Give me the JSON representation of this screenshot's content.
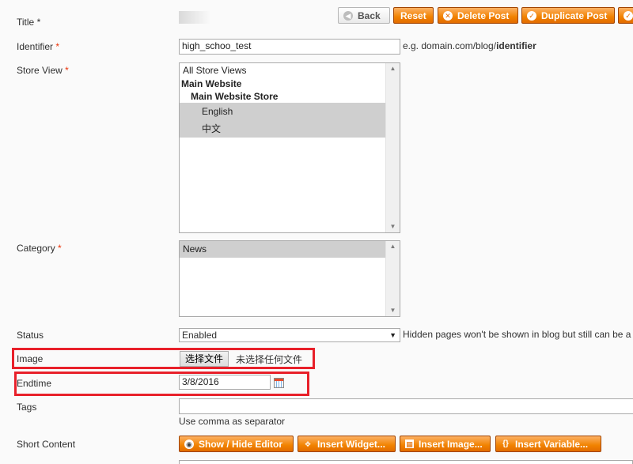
{
  "header": {
    "back_label": "Back",
    "reset_label": "Reset",
    "delete_label": "Delete Post",
    "duplicate_label": "Duplicate Post"
  },
  "form": {
    "title": {
      "label": "Title",
      "required": "*"
    },
    "identifier": {
      "label": "Identifier",
      "required": "*",
      "value": "high_schoo_test",
      "note_prefix": "e.g. domain.com/blog/",
      "note_bold": "identifier"
    },
    "store_view": {
      "label": "Store View",
      "required": "*",
      "options": [
        {
          "text": "All Store Views",
          "style": "normal",
          "selected": false
        },
        {
          "text": "Main Website",
          "style": "bold",
          "selected": false
        },
        {
          "text": "Main Website Store",
          "style": "bold",
          "selected": false
        },
        {
          "text": "English",
          "style": "normal",
          "selected": true
        },
        {
          "text": "中文",
          "style": "normal",
          "selected": true
        }
      ]
    },
    "category": {
      "label": "Category",
      "required": "*",
      "options": [
        {
          "text": "News",
          "selected": true
        }
      ]
    },
    "status": {
      "label": "Status",
      "value": "Enabled",
      "note": "Hidden pages won't be shown in blog but still can be a"
    },
    "image": {
      "label": "Image",
      "button_label": "选择文件",
      "file_text": "未选择任何文件"
    },
    "endtime": {
      "label": "Endtime",
      "value": "3/8/2016"
    },
    "tags": {
      "label": "Tags",
      "value": "",
      "hint": "Use comma as separator"
    },
    "short_content": {
      "label": "Short Content",
      "buttons": [
        "Show / Hide Editor",
        "Insert Widget...",
        "Insert Image...",
        "Insert Variable..."
      ]
    }
  },
  "icons": [
    "back-icon",
    "delete-icon",
    "check-icon",
    "calendar-icon",
    "eye-icon",
    "widget-icon",
    "image-icon",
    "variable-icon",
    "scroll-up-icon",
    "scroll-down-icon",
    "dropdown-arrow-icon"
  ],
  "colors": {
    "accent": "#f18200",
    "highlight": "#e8202a",
    "required": "#eb340a"
  }
}
